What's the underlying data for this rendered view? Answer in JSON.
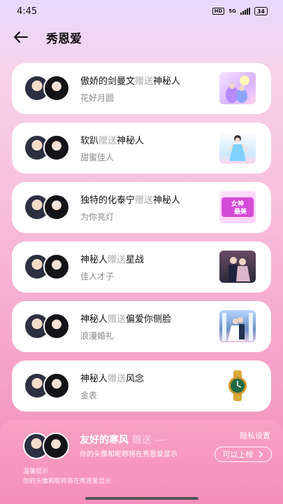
{
  "status_bar": {
    "time": "4:45",
    "hd": "HD",
    "network": "5G",
    "battery": "34"
  },
  "header": {
    "title": "秀恩爱"
  },
  "list": [
    {
      "sender": "傲娇的剑曼文",
      "verb": "赠送",
      "receiver": "神秘人",
      "gift_name": "花好月圆",
      "gift_icon": "flower-moon-gift"
    },
    {
      "sender": "软趴",
      "verb": "赠送",
      "receiver": "神秘人",
      "gift_name": "甜蜜佳人",
      "gift_icon": "sweet-beauty-gift"
    },
    {
      "sender": "独特的化泰宁",
      "verb": "赠送",
      "receiver": "神秘人",
      "gift_name": "为你亮灯",
      "gift_icon": "light-for-you-gift",
      "gift_overlay": "女神\n最美"
    },
    {
      "sender": "神秘人",
      "verb": "赠送",
      "receiver": "星战",
      "gift_name": "佳人才子",
      "gift_icon": "couple-gift"
    },
    {
      "sender": "神秘人",
      "verb": "赠送",
      "receiver": "偏爱你侧脸",
      "gift_name": "浪漫婚礼",
      "gift_icon": "wedding-gift"
    },
    {
      "sender": "神秘人",
      "verb": "赠送",
      "receiver": "风念",
      "gift_name": "金表",
      "gift_icon": "gold-watch-gift"
    }
  ],
  "bottom_panel": {
    "name": "友好的寒风",
    "verb": "赠送",
    "placeholder": "---",
    "notice": "你的头像和昵称将在秀恩爱显示",
    "privacy_label": "隐私设置",
    "rank_button": "可以上榜",
    "tip_title": "温馨提示",
    "tip_text": "你的头像和昵称将在秀恩爱显示"
  }
}
